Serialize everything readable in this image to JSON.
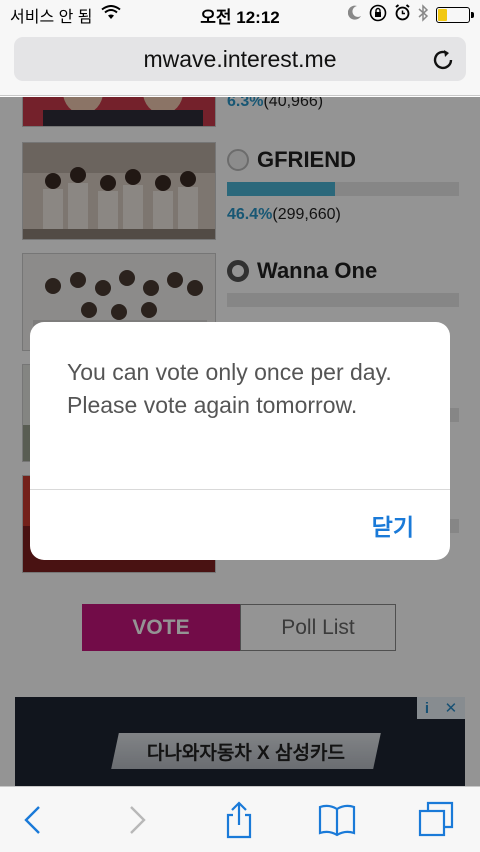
{
  "status_bar": {
    "carrier": "서비스 안 됨",
    "time": "오전 12:12",
    "battery_level": 0.3,
    "battery_color": "#f2c811"
  },
  "browser": {
    "url": "mwave.interest.me"
  },
  "ranking": [
    {
      "name": "",
      "percent": "6.3%",
      "votes": "(40,966)",
      "fraction": 0.063,
      "selected": false
    },
    {
      "name": "GFRIEND",
      "percent": "46.4%",
      "votes": "(299,660)",
      "fraction": 0.464,
      "selected": false
    },
    {
      "name": "Wanna One",
      "percent": "",
      "votes": "",
      "fraction": 0.0,
      "selected": true
    }
  ],
  "buttons": {
    "vote": "VOTE",
    "poll_list": "Poll List"
  },
  "ad": {
    "banner_text": "다나와자동차 X 삼성카드",
    "info_icon": "i",
    "close_icon": "✕"
  },
  "dialog": {
    "message": "You can vote only once per day. Please vote again tomorrow.",
    "close_label": "닫기"
  },
  "colors": {
    "vote_button": "#c4157c",
    "link_blue": "#1a7ad8",
    "percent_blue": "#2a96c8"
  },
  "icons": {
    "back": "chevron-left-icon",
    "forward": "chevron-right-icon",
    "share": "share-icon",
    "bookmarks": "book-icon",
    "tabs": "tabs-icon"
  }
}
